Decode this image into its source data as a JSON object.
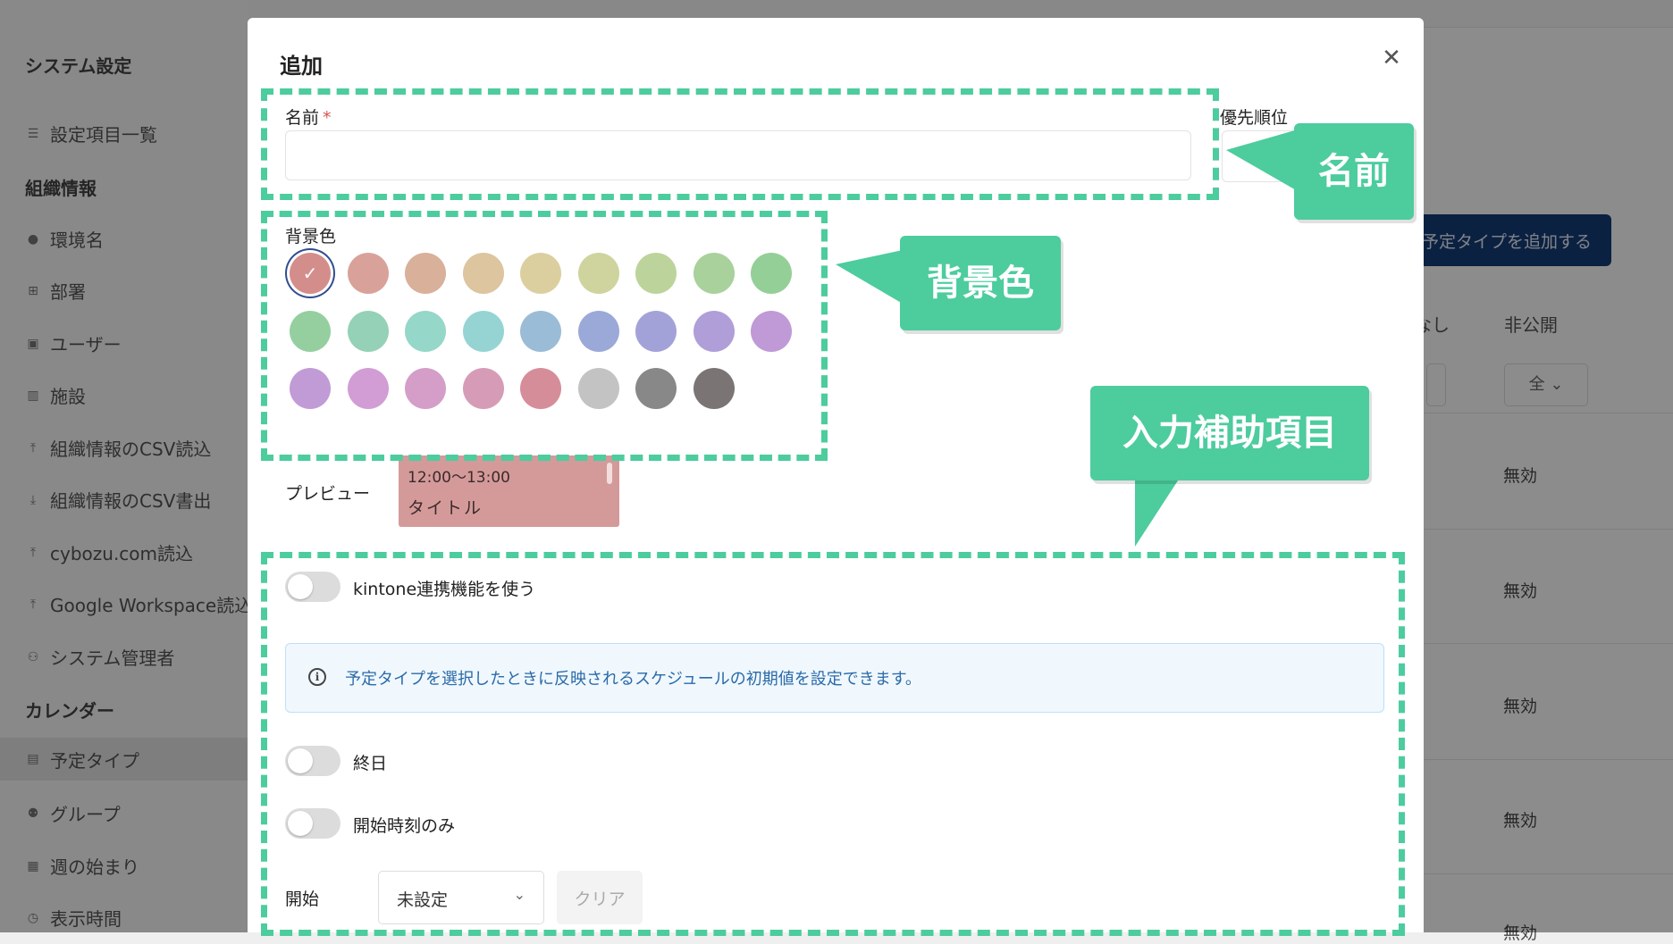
{
  "sidebar": {
    "system_title": "システム設定",
    "settings_list": "設定項目一覧",
    "org_title": "組織情報",
    "org_items": [
      "環境名",
      "部署",
      "ユーザー",
      "施設",
      "組織情報のCSV読込",
      "組織情報のCSV書出",
      "cybozu.com読込",
      "Google Workspace読込",
      "システム管理者"
    ],
    "calendar_title": "カレンダー",
    "calendar_items": [
      "予定タイプ",
      "グループ",
      "週の始まり",
      "表示時間"
    ]
  },
  "main": {
    "add_button": "予定タイプを追加する",
    "header_partial": "なし",
    "header_private": "非公開",
    "filter_value": "全",
    "row_status": [
      "無効",
      "無効",
      "無効",
      "無効",
      "無効"
    ]
  },
  "modal": {
    "title": "追加",
    "name_label": "名前",
    "required_mark": "*",
    "priority_label": "優先順位",
    "bg_label": "背景色",
    "colors": [
      "#d38e8c",
      "#d8a29a",
      "#d9b09a",
      "#dcc59f",
      "#dccf9f",
      "#cfd49e",
      "#bcd49c",
      "#a8d19c",
      "#95cf98",
      "#95cfa0",
      "#94d1b6",
      "#95d7c8",
      "#96d4d4",
      "#9bbcd6",
      "#9ba9d8",
      "#a3a2d8",
      "#b09ed8",
      "#bf9ad6",
      "#c19bd6",
      "#d19dd4",
      "#d49ec8",
      "#d69cb7",
      "#d68d9a",
      "#c3c3c3",
      "#888888",
      "#7a7475"
    ],
    "selected_color_index": 0,
    "preview_label": "プレビュー",
    "preview_time": "12:00〜13:00",
    "preview_title": "タイトル",
    "kintone_label": "kintone連携機能を使う",
    "info_text": "予定タイプを選択したときに反映されるスケジュールの初期値を設定できます。",
    "allday_label": "終日",
    "starttime_label": "開始時刻のみ",
    "start_label": "開始",
    "start_value": "未設定",
    "clear_button": "クリア"
  },
  "annotations": {
    "name_callout": "名前",
    "bg_callout": "背景色",
    "input_callout": "入力補助項目",
    "color": "#4dcc9e"
  }
}
